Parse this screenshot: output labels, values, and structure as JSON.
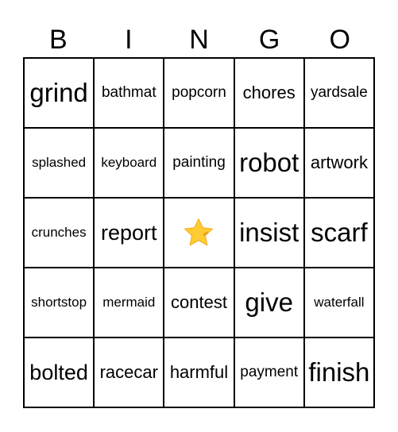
{
  "header": {
    "letters": [
      "B",
      "I",
      "N",
      "G",
      "O"
    ]
  },
  "board": {
    "rows": [
      [
        {
          "text": "grind",
          "size": "xl"
        },
        {
          "text": "bathmat",
          "size": "s"
        },
        {
          "text": "popcorn",
          "size": "s"
        },
        {
          "text": "chores",
          "size": "m"
        },
        {
          "text": "yardsale",
          "size": "s"
        }
      ],
      [
        {
          "text": "splashed",
          "size": "xs"
        },
        {
          "text": "keyboard",
          "size": "xs"
        },
        {
          "text": "painting",
          "size": "s"
        },
        {
          "text": "robot",
          "size": "xl"
        },
        {
          "text": "artwork",
          "size": "m"
        }
      ],
      [
        {
          "text": "crunches",
          "size": "xs"
        },
        {
          "text": "report",
          "size": "l"
        },
        {
          "text": "",
          "size": "free",
          "icon": "star-icon"
        },
        {
          "text": "insist",
          "size": "xl"
        },
        {
          "text": "scarf",
          "size": "xl"
        }
      ],
      [
        {
          "text": "shortstop",
          "size": "xs"
        },
        {
          "text": "mermaid",
          "size": "xs"
        },
        {
          "text": "contest",
          "size": "m"
        },
        {
          "text": "give",
          "size": "xl"
        },
        {
          "text": "waterfall",
          "size": "xs"
        }
      ],
      [
        {
          "text": "bolted",
          "size": "l"
        },
        {
          "text": "racecar",
          "size": "m"
        },
        {
          "text": "harmful",
          "size": "m"
        },
        {
          "text": "payment",
          "size": "s"
        },
        {
          "text": "finish",
          "size": "xl"
        }
      ]
    ],
    "free_space": {
      "icon": "star-icon",
      "color": "#FFCC33"
    }
  }
}
